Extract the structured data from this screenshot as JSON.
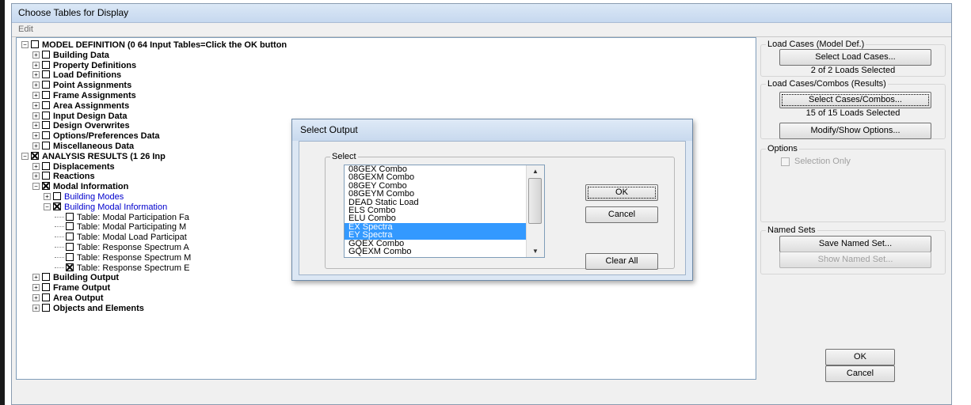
{
  "window": {
    "title": "Choose Tables for Display",
    "menu_edit": "Edit"
  },
  "tree": [
    {
      "exp": "minus",
      "check": "empty",
      "label": "MODEL DEFINITION  (0  64 Input Tables=Click the OK button",
      "bold": true,
      "indent": 0,
      "row": 0
    },
    {
      "exp": "plus",
      "check": "empty",
      "label": "Building Data",
      "bold": true,
      "indent": 1,
      "row": 1
    },
    {
      "exp": "plus",
      "check": "empty",
      "label": "Property Definitions",
      "bold": true,
      "indent": 1,
      "row": 2
    },
    {
      "exp": "plus",
      "check": "empty",
      "label": "Load Definitions",
      "bold": true,
      "indent": 1,
      "row": 3
    },
    {
      "exp": "plus",
      "check": "empty",
      "label": "Point Assignments",
      "bold": true,
      "indent": 1,
      "row": 4
    },
    {
      "exp": "plus",
      "check": "empty",
      "label": "Frame Assignments",
      "bold": true,
      "indent": 1,
      "row": 5
    },
    {
      "exp": "plus",
      "check": "empty",
      "label": "Area Assignments",
      "bold": true,
      "indent": 1,
      "row": 6
    },
    {
      "exp": "plus",
      "check": "empty",
      "label": "Input Design Data",
      "bold": true,
      "indent": 1,
      "row": 7
    },
    {
      "exp": "plus",
      "check": "empty",
      "label": "Design Overwrites",
      "bold": true,
      "indent": 1,
      "row": 8
    },
    {
      "exp": "plus",
      "check": "empty",
      "label": "Options/Preferences Data",
      "bold": true,
      "indent": 1,
      "row": 9
    },
    {
      "exp": "plus",
      "check": "empty",
      "label": "Miscellaneous Data",
      "bold": true,
      "indent": 1,
      "row": 10
    },
    {
      "exp": "minus",
      "check": "x",
      "label": "ANALYSIS RESULTS  (1  26 Inp",
      "bold": true,
      "indent": 0,
      "row": 11
    },
    {
      "exp": "plus",
      "check": "empty",
      "label": "Displacements",
      "bold": true,
      "indent": 1,
      "row": 12
    },
    {
      "exp": "plus",
      "check": "empty",
      "label": "Reactions",
      "bold": true,
      "indent": 1,
      "row": 13
    },
    {
      "exp": "minus",
      "check": "x",
      "label": "Modal Information",
      "bold": true,
      "indent": 1,
      "row": 14
    },
    {
      "exp": "plus",
      "check": "empty",
      "label": "Building Modes",
      "blue": true,
      "indent": 2,
      "row": 15
    },
    {
      "exp": "minus",
      "check": "x",
      "label": "Building Modal Information",
      "blue": true,
      "indent": 2,
      "row": 16
    },
    {
      "exp": "line",
      "check": "empty",
      "label": "Table:  Modal Participation Fa",
      "indent": 3,
      "row": 17
    },
    {
      "exp": "line",
      "check": "empty",
      "label": "Table:  Modal Participating M",
      "indent": 3,
      "row": 18
    },
    {
      "exp": "line",
      "check": "empty",
      "label": "Table:  Modal Load Participat",
      "indent": 3,
      "row": 19
    },
    {
      "exp": "line",
      "check": "empty",
      "label": "Table:  Response Spectrum A",
      "indent": 3,
      "row": 20
    },
    {
      "exp": "line",
      "check": "empty",
      "label": "Table:  Response Spectrum M",
      "indent": 3,
      "row": 21
    },
    {
      "exp": "line",
      "check": "x",
      "label": "Table:  Response Spectrum E",
      "indent": 3,
      "row": 22
    },
    {
      "exp": "plus",
      "check": "empty",
      "label": "Building Output",
      "bold": true,
      "indent": 1,
      "row": 23
    },
    {
      "exp": "plus",
      "check": "empty",
      "label": "Frame Output",
      "bold": true,
      "indent": 1,
      "row": 24
    },
    {
      "exp": "plus",
      "check": "empty",
      "label": "Area Output",
      "bold": true,
      "indent": 1,
      "row": 25
    },
    {
      "exp": "plus",
      "check": "empty",
      "label": "Objects and Elements",
      "bold": true,
      "indent": 1,
      "row": 26
    }
  ],
  "right_panel": {
    "load_cases_group": "Load Cases (Model Def.)",
    "select_load_cases": "Select Load Cases...",
    "load_cases_status": "2  of  2  Loads Selected",
    "combos_group": "Load Cases/Combos (Results)",
    "select_cases_combos": "Select Cases/Combos...",
    "combos_status": "15  of  15  Loads Selected",
    "modify_show": "Modify/Show Options...",
    "options_group": "Options",
    "selection_only": "Selection Only",
    "named_sets_group": "Named Sets",
    "save_named_set": "Save Named Set...",
    "show_named_set": "Show Named Set...",
    "ok": "OK",
    "cancel": "Cancel"
  },
  "dialog": {
    "title": "Select Output",
    "select_group": "Select",
    "items": [
      {
        "label": "08GEX Combo",
        "selected": false
      },
      {
        "label": "08GEXM Combo",
        "selected": false
      },
      {
        "label": "08GEY Combo",
        "selected": false
      },
      {
        "label": "08GEYM Combo",
        "selected": false
      },
      {
        "label": "DEAD Static Load",
        "selected": false
      },
      {
        "label": "ELS Combo",
        "selected": false
      },
      {
        "label": "ELU Combo",
        "selected": false
      },
      {
        "label": "EX Spectra",
        "selected": true
      },
      {
        "label": "EY Spectra",
        "selected": true
      },
      {
        "label": "GQEX Combo",
        "selected": false
      },
      {
        "label": "GQEXM Combo",
        "selected": false
      }
    ],
    "ok": "OK",
    "cancel": "Cancel",
    "clear_all": "Clear All"
  }
}
